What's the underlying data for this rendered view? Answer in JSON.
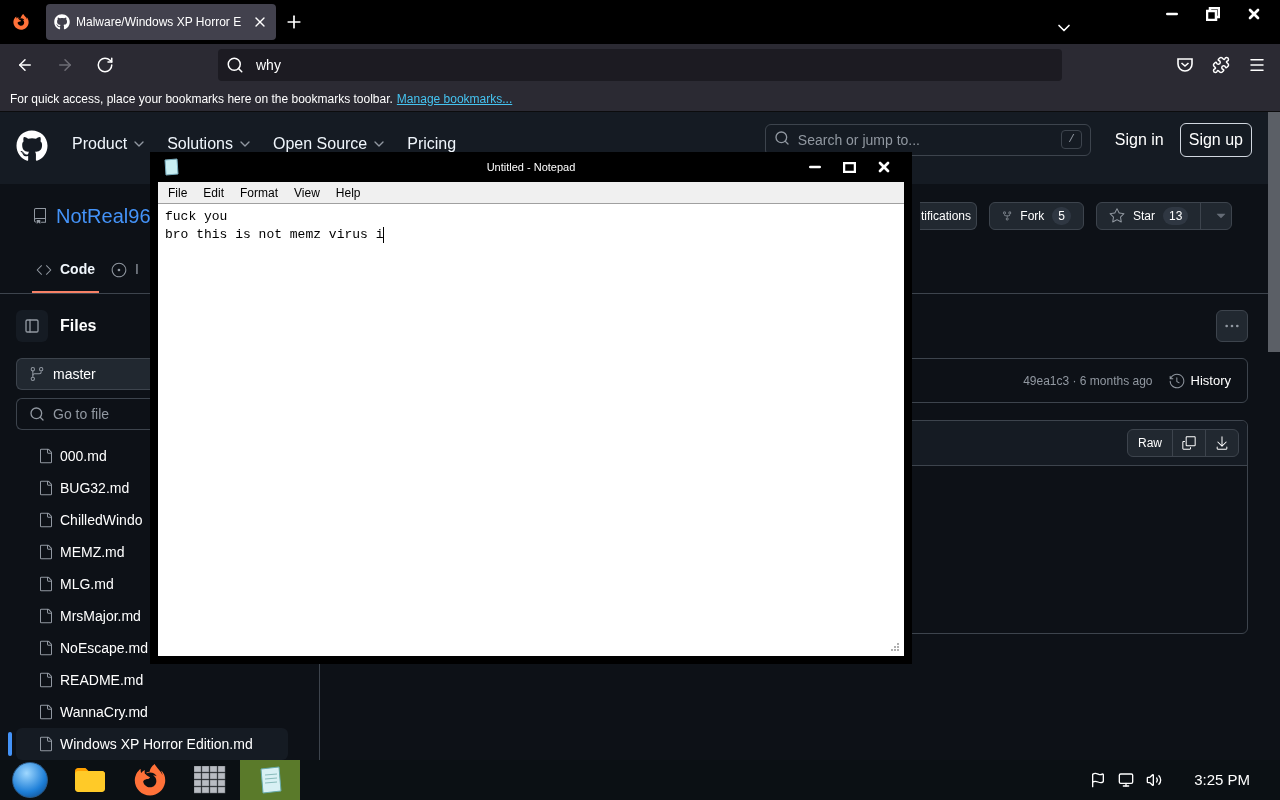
{
  "browser": {
    "tabs": [
      {
        "title": "Malware/Windows XP Horror E",
        "selected": true
      }
    ],
    "nav_buttons": [
      {
        "kind": "back",
        "disabled": false
      },
      {
        "kind": "forward",
        "disabled": true
      },
      {
        "kind": "reload",
        "disabled": false
      }
    ],
    "url_field": {
      "value": "why"
    },
    "bookmarks_bar": {
      "message": "For quick access, place your bookmarks here on the bookmarks toolbar.",
      "link": "Manage bookmarks..."
    }
  },
  "github": {
    "header": {
      "nav": [
        {
          "label": "Product",
          "dropdown": true
        },
        {
          "label": "Solutions",
          "dropdown": true
        },
        {
          "label": "Open Source",
          "dropdown": true
        },
        {
          "label": "Pricing",
          "dropdown": false
        }
      ],
      "search": {
        "placeholder": "Search or jump to...",
        "shortcut": "/"
      },
      "sign_in": "Sign in",
      "sign_up": "Sign up"
    },
    "repo": {
      "owner": "NotReal96",
      "notifications": "tifications",
      "fork": {
        "label": "Fork",
        "count": "5"
      },
      "star": {
        "label": "Star",
        "count": "13"
      }
    },
    "tabs": [
      {
        "label": "Code",
        "kind": "code",
        "selected": true
      },
      {
        "label": "I",
        "kind": "issues",
        "selected": false
      }
    ],
    "sidebar": {
      "title": "Files",
      "branch": "master",
      "search": {
        "placeholder": "Go to file"
      },
      "files": [
        {
          "name": "000.md",
          "selected": false
        },
        {
          "name": "BUG32.md",
          "selected": false
        },
        {
          "name": "ChilledWindo",
          "selected": false
        },
        {
          "name": "MEMZ.md",
          "selected": false
        },
        {
          "name": "MLG.md",
          "selected": false
        },
        {
          "name": "MrsMajor.md",
          "selected": false
        },
        {
          "name": "NoEscape.md",
          "selected": false
        },
        {
          "name": "README.md",
          "selected": false
        },
        {
          "name": "WannaCry.md",
          "selected": false
        },
        {
          "name": "Windows XP Horror Edition.md",
          "selected": true
        }
      ]
    },
    "commit": {
      "info": "49ea1c3 · 6 months ago",
      "history": "History"
    },
    "file_actions": {
      "raw": "Raw"
    }
  },
  "notepad": {
    "title": "Untitled - Notepad",
    "menu": [
      "File",
      "Edit",
      "Format",
      "View",
      "Help"
    ],
    "lines": [
      "fuck you",
      "bro this is not memz virus i"
    ]
  },
  "taskbar": {
    "apps": [
      {
        "kind": "start",
        "active": false
      },
      {
        "kind": "explorer",
        "active": false
      },
      {
        "kind": "firefox",
        "active": false
      },
      {
        "kind": "firewall",
        "active": false
      },
      {
        "kind": "notepad",
        "active": true
      }
    ],
    "clock": "3:25 PM"
  }
}
